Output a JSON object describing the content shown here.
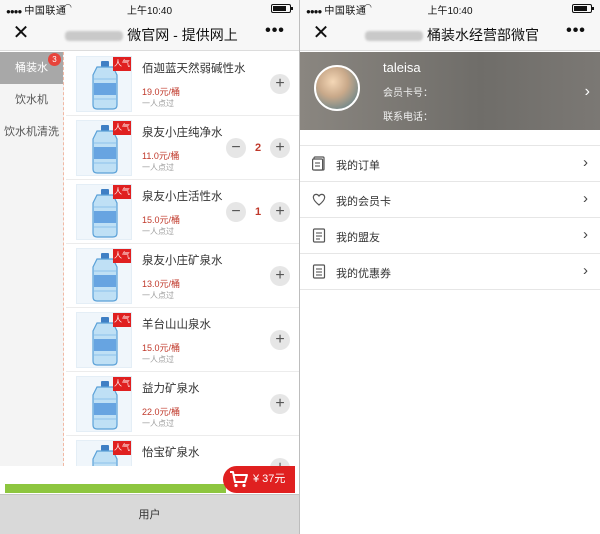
{
  "status_bar": {
    "carrier": "中国联通",
    "time": "上午10:40"
  },
  "left": {
    "title": "微官网 - 提供网上",
    "categories": [
      {
        "label": "桶装水",
        "badge": "3"
      },
      {
        "label": "饮水机"
      },
      {
        "label": "饮水机清洗"
      }
    ],
    "hot_tag": "人气",
    "products": [
      {
        "name": "佰迦蓝天然弱碱性水",
        "price": "19.0元/桶",
        "fans": "一人点过",
        "qty": ""
      },
      {
        "name": "泉友小庄纯净水",
        "price": "11.0元/桶",
        "fans": "一人点过",
        "qty": "2"
      },
      {
        "name": "泉友小庄活性水",
        "price": "15.0元/桶",
        "fans": "一人点过",
        "qty": "1"
      },
      {
        "name": "泉友小庄矿泉水",
        "price": "13.0元/桶",
        "fans": "一人点过",
        "qty": ""
      },
      {
        "name": "羊台山山泉水",
        "price": "15.0元/桶",
        "fans": "一人点过",
        "qty": ""
      },
      {
        "name": "益力矿泉水",
        "price": "22.0元/桶",
        "fans": "一人点过",
        "qty": ""
      },
      {
        "name": "怡宝矿泉水",
        "price": "",
        "fans": "",
        "qty": ""
      }
    ],
    "plus_label": "+",
    "minus_label": "−",
    "cart_total": "¥ 37元",
    "bottom_tab": "用户"
  },
  "right": {
    "title": "桶装水经营部微官",
    "username": "taleisa",
    "member_card_label": "会员卡号：",
    "phone_label": "联系电话：",
    "menu": [
      {
        "label": "我的订单",
        "icon": "order-icon"
      },
      {
        "label": "我的会员卡",
        "icon": "heart-icon"
      },
      {
        "label": "我的盟友",
        "icon": "list-icon"
      },
      {
        "label": "我的优惠券",
        "icon": "coupon-icon"
      }
    ]
  },
  "colors": {
    "accent_red": "#e02020",
    "progress_green": "#8dc63f",
    "price_red": "#c0392b"
  }
}
